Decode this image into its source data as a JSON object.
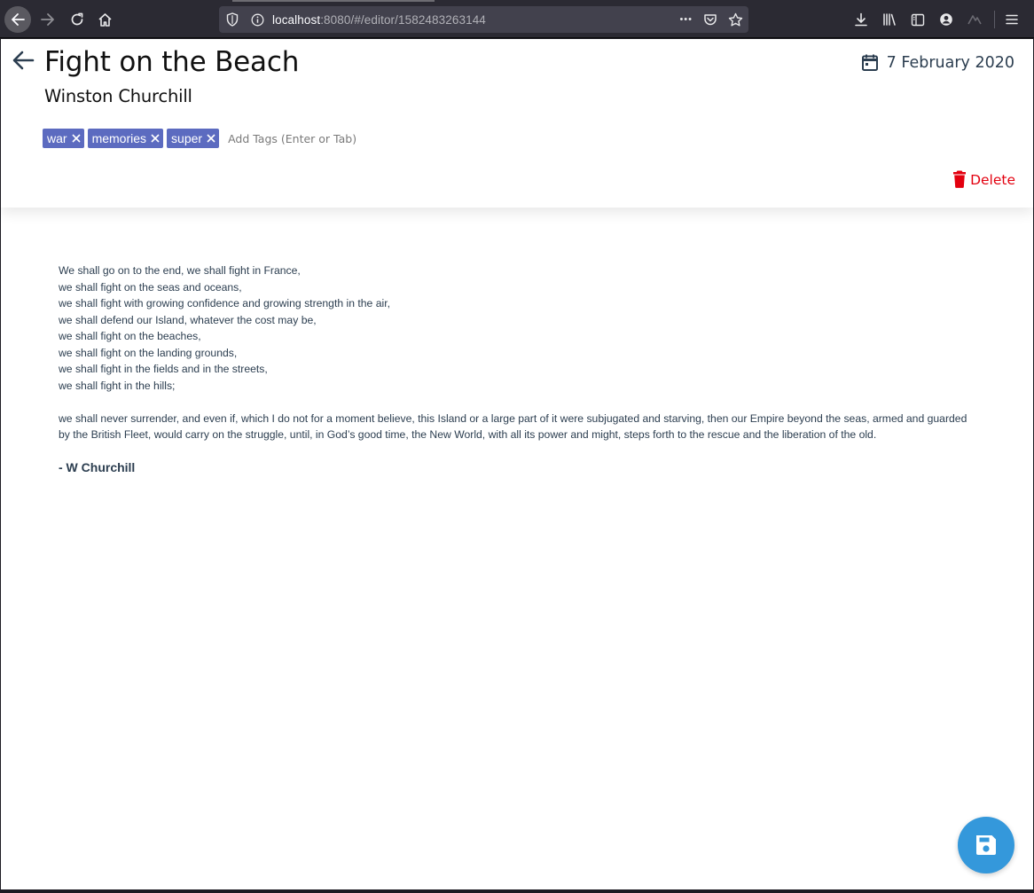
{
  "browser": {
    "url_host": "localhost",
    "url_path": ":8080/#/editor/1582483263144",
    "overflow_dots": "•••"
  },
  "header": {
    "title": "Fight on the Beach",
    "author": "Winston Churchill",
    "date": "7 February 2020",
    "tags": [
      {
        "label": "war"
      },
      {
        "label": "memories"
      },
      {
        "label": "super"
      }
    ],
    "tag_placeholder": "Add Tags (Enter or Tab)",
    "delete_label": "Delete"
  },
  "content": {
    "lines": [
      "We shall go on to the end, we shall fight in France,",
      "we shall fight on the seas and oceans,",
      "we shall fight with growing confidence and growing strength in the air,",
      "we shall defend our Island, whatever the cost may be,",
      "we shall fight on the beaches,",
      "we shall fight on the landing grounds,",
      "we shall fight in the fields and in the streets,",
      "we shall fight in the hills;"
    ],
    "paragraph2": "we shall never surrender, and even if, which I do not for a moment believe, this Island or a large part of it were subjugated and starving, then our Empire beyond the seas, armed and guarded by the British Fleet, would carry on the struggle, until, in God’s good time, the New World, with all its power and might, steps forth to the rescue and the liberation of the old.",
    "signature": "- W Churchill"
  },
  "colors": {
    "tag_bg": "#5c6bc0",
    "delete": "#e3000f",
    "fab": "#3498db",
    "text": "#2c3e50"
  },
  "icons": [
    "back-icon",
    "forward-icon",
    "reload-icon",
    "home-icon",
    "shield-icon",
    "info-icon",
    "pocket-icon",
    "star-icon",
    "download-icon",
    "library-icon",
    "sidebar-icon",
    "account-icon",
    "extension-icon",
    "menu-icon",
    "arrow-left-icon",
    "calendar-icon",
    "close-icon",
    "trash-icon",
    "save-icon"
  ]
}
